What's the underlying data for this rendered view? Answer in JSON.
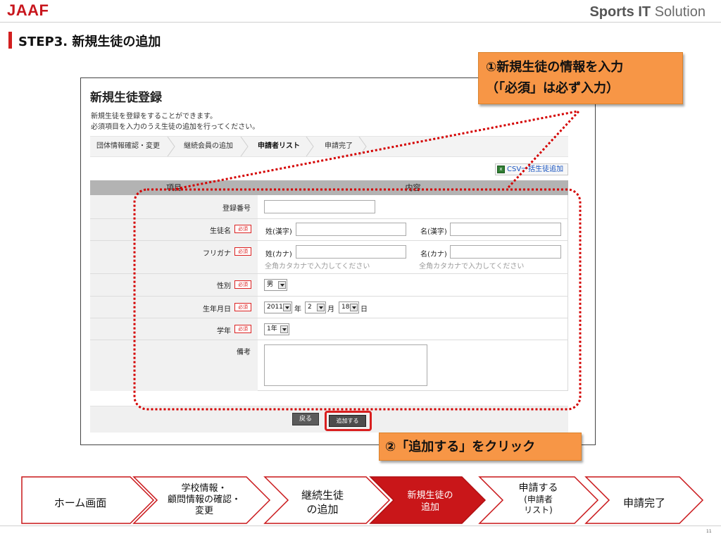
{
  "header": {
    "logo": "JAAF",
    "brand_bold": "Sports",
    "brand_it": "IT",
    "brand_rest": "Solution",
    "slide_title": "STEP3. 新規生徒の追加"
  },
  "form": {
    "title": "新規生徒登録",
    "desc_line1": "新規生徒を登録をすることができます。",
    "desc_line2": "必須項目を入力のうえ生徒の追加を行ってください。",
    "steps": [
      "団体情報確認・変更",
      "継続会員の追加",
      "申請者リスト",
      "申請完了"
    ],
    "current_step": "申請者リスト",
    "csv_label": "CSV一括生徒追加",
    "table_head_item": "項目",
    "table_head_content": "内容",
    "required_badge": "必須",
    "fields": {
      "reg_no_label": "登録番号",
      "name_label": "生徒名",
      "name_sei": "姓(漢字)",
      "name_mei": "名(漢字)",
      "kana_label": "フリガナ",
      "kana_sei": "姓(カナ)",
      "kana_mei": "名(カナ)",
      "kana_hint": "全角カタカナで入力してください",
      "gender_label": "性別",
      "gender_value": "男",
      "birth_label": "生年月日",
      "birth_year": "2011",
      "birth_year_unit": "年",
      "birth_month": "2",
      "birth_month_unit": "月",
      "birth_day": "18",
      "birth_day_unit": "日",
      "grade_label": "学年",
      "grade_value": "1年",
      "remarks_label": "備考"
    },
    "back_button": "戻る",
    "add_button": "追加する"
  },
  "callouts": {
    "c1_line1": "①新規生徒の情報を入力",
    "c1_line2": "（「必須」は必ず入力）",
    "c2": "②「追加する」をクリック"
  },
  "flow": {
    "s1": "ホーム画面",
    "s2_l1": "学校情報・",
    "s2_l2": "顧問情報の確認・",
    "s2_l3": "変更",
    "s3_l1": "継続生徒",
    "s3_l2": "の追加",
    "s4_l1": "新規生徒の",
    "s4_l2": "追加",
    "s5_l1": "申請する",
    "s5_l2": "(申請者",
    "s5_l3": "リスト)",
    "s6": "申請完了"
  },
  "page_number": "11",
  "colors": {
    "brand_red": "#c8161d",
    "callout_orange": "#f79646",
    "dotted_red": "#d40000",
    "active_flow": "#c91619"
  }
}
